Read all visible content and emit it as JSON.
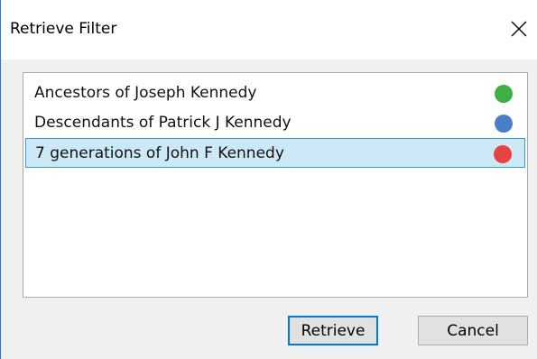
{
  "dialog": {
    "title": "Retrieve Filter",
    "close_icon": "close-icon"
  },
  "filters": [
    {
      "label": "Ancestors of Joseph Kennedy",
      "color": "#3cb043",
      "selected": false
    },
    {
      "label": "Descendants of Patrick J Kennedy",
      "color": "#4a7fc8",
      "selected": false
    },
    {
      "label": "7 generations of John F Kennedy",
      "color": "#e84343",
      "selected": true
    }
  ],
  "buttons": {
    "retrieve_label": "Retrieve",
    "cancel_label": "Cancel"
  },
  "colors": {
    "selection_background": "#cde8f7",
    "selection_border": "#3399dd",
    "accent": "#0078d7"
  }
}
